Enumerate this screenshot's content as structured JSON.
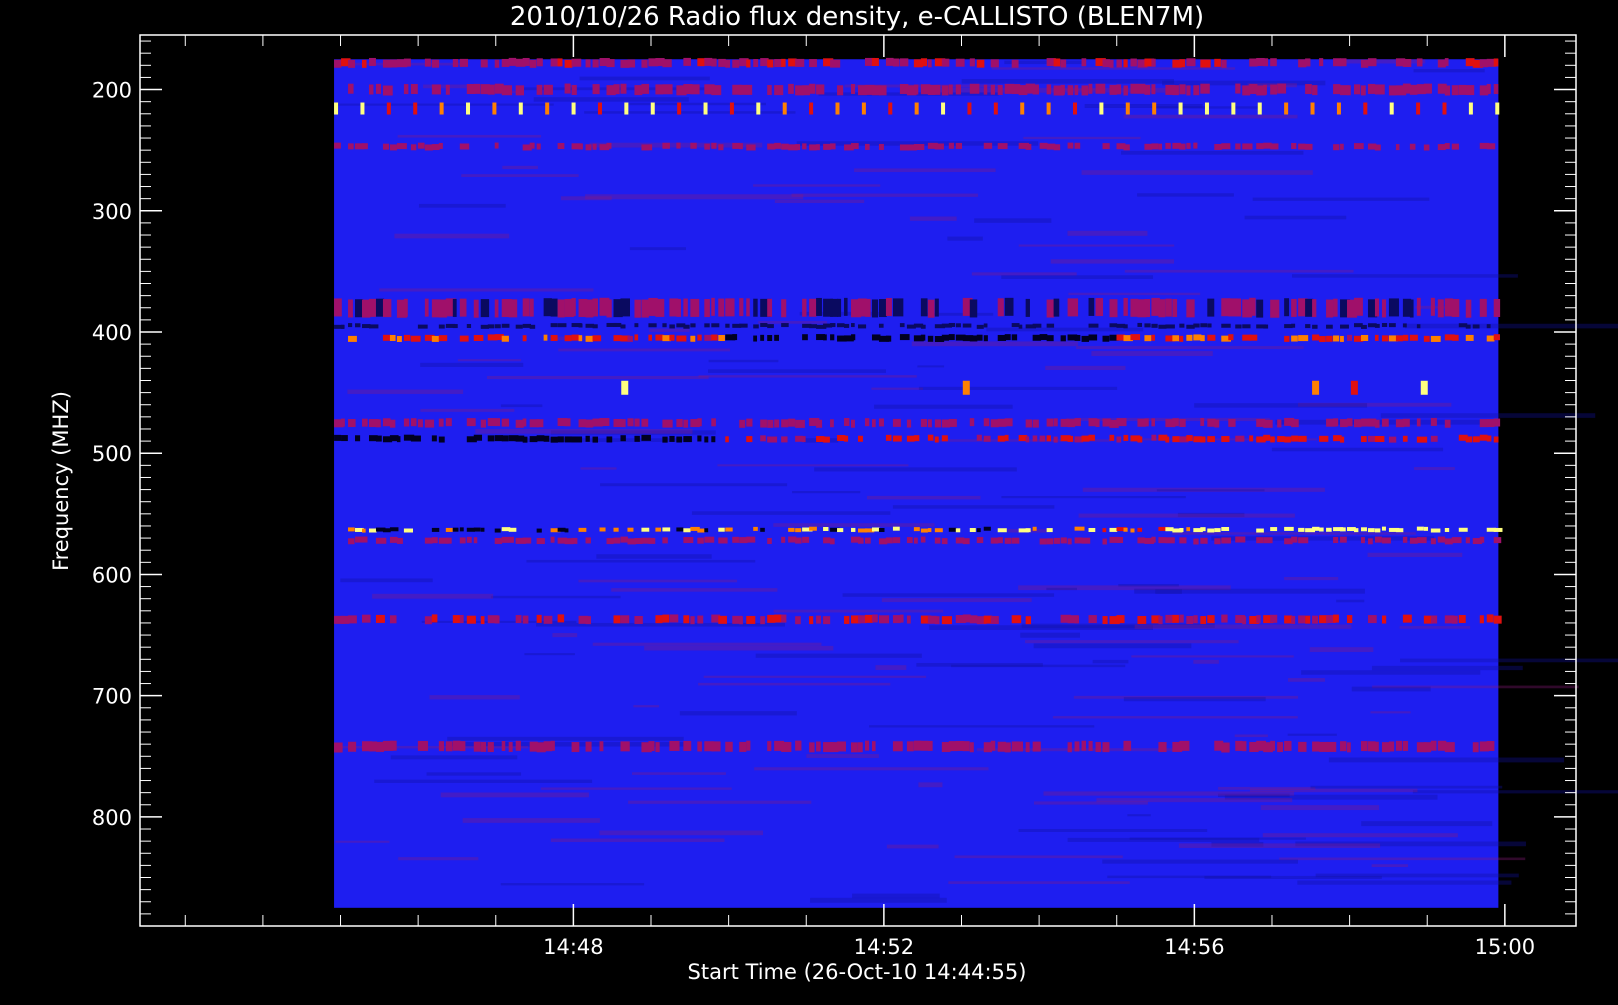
{
  "chart_data": {
    "type": "heatmap",
    "title": "2010/10/26  Radio flux density, e-CALLISTO (BLEN7M)",
    "xlabel": "Start Time (26-Oct-10 14:44:55)",
    "ylabel": "Frequency (MHZ)",
    "x_tick_labels": [
      "14:48",
      "14:52",
      "14:56",
      "15:00"
    ],
    "x_tick_values_min": [
      3.0833,
      7.0833,
      11.0833,
      15.0833
    ],
    "x_range_min": [
      -2.5,
      16.0
    ],
    "data_extent_min": [
      0.0,
      15.0
    ],
    "y_tick_labels": [
      "200",
      "300",
      "400",
      "500",
      "600",
      "700",
      "800"
    ],
    "y_tick_values": [
      200,
      300,
      400,
      500,
      600,
      700,
      800
    ],
    "y_range": [
      155,
      890
    ],
    "data_extent_freq": [
      175,
      875
    ],
    "y_inverted": true,
    "colormap": [
      "#000000",
      "#0000ff",
      "#ff0000",
      "#ffff00",
      "#ffffff"
    ],
    "background_color": "#1e1ef0",
    "bands": [
      {
        "freq": 178,
        "intensity": 0.55,
        "width": 10
      },
      {
        "freq": 200,
        "intensity": 0.45,
        "width": 12
      },
      {
        "freq": 214,
        "intensity": 0.9,
        "width": 8,
        "pattern": "pulsed"
      },
      {
        "freq": 247,
        "intensity": 0.5,
        "width": 8
      },
      {
        "freq": 380,
        "intensity": 0.35,
        "width": 20
      },
      {
        "freq": 395,
        "intensity": 0.15,
        "width": 6,
        "dark": true
      },
      {
        "freq": 405,
        "intensity": 0.8,
        "width": 8
      },
      {
        "freq": 475,
        "intensity": 0.45,
        "width": 10
      },
      {
        "freq": 488,
        "intensity": 0.7,
        "width": 8
      },
      {
        "freq": 563,
        "intensity": 1.0,
        "width": 6
      },
      {
        "freq": 572,
        "intensity": 0.45,
        "width": 8
      },
      {
        "freq": 637,
        "intensity": 0.6,
        "width": 10
      },
      {
        "freq": 742,
        "intensity": 0.45,
        "width": 12
      }
    ],
    "bursts": [
      {
        "t": 3.7,
        "freq": 446,
        "intensity": 0.9
      },
      {
        "t": 8.1,
        "freq": 446,
        "intensity": 0.7
      },
      {
        "t": 12.6,
        "freq": 446,
        "intensity": 0.75
      },
      {
        "t": 13.1,
        "freq": 446,
        "intensity": 0.6
      },
      {
        "t": 14.0,
        "freq": 446,
        "intensity": 1.0
      }
    ]
  }
}
